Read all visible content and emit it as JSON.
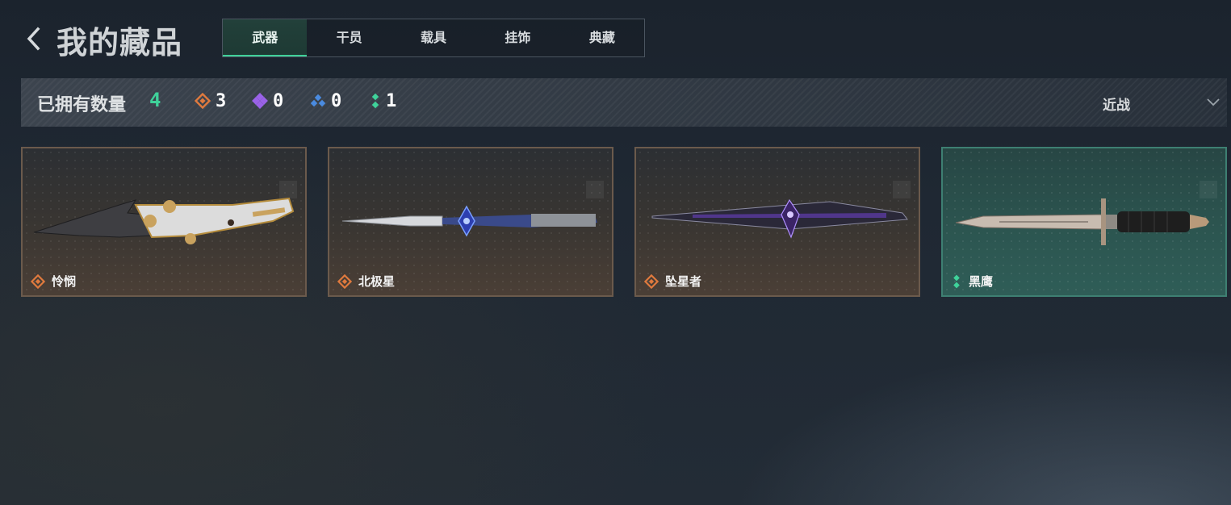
{
  "header": {
    "title": "我的藏品",
    "tabs": [
      {
        "label": "武器",
        "active": true
      },
      {
        "label": "干员",
        "active": false
      },
      {
        "label": "载具",
        "active": false
      },
      {
        "label": "挂饰",
        "active": false
      },
      {
        "label": "典藏",
        "active": false
      }
    ]
  },
  "stats": {
    "owned_label": "已拥有数量",
    "owned_count": "4",
    "rarities": [
      {
        "icon": "orange-diamond-icon",
        "color": "#e07a3e",
        "count": "3"
      },
      {
        "icon": "purple-diamond-icon",
        "color": "#9a62e8",
        "count": "0"
      },
      {
        "icon": "blue-diamond-icon",
        "color": "#4a8be0",
        "count": "0"
      },
      {
        "icon": "green-diamond-icon",
        "color": "#3fd29a",
        "count": "1"
      }
    ],
    "filter_label": "近战"
  },
  "items": [
    {
      "name": "怜悯",
      "rarity": "orange"
    },
    {
      "name": "北极星",
      "rarity": "orange"
    },
    {
      "name": "坠星者",
      "rarity": "orange"
    },
    {
      "name": "黑鹰",
      "rarity": "green"
    }
  ],
  "colors": {
    "accent": "#3fd29a",
    "orange": "#e07a3e",
    "purple": "#9a62e8",
    "blue": "#4a8be0",
    "green": "#3fd29a"
  }
}
